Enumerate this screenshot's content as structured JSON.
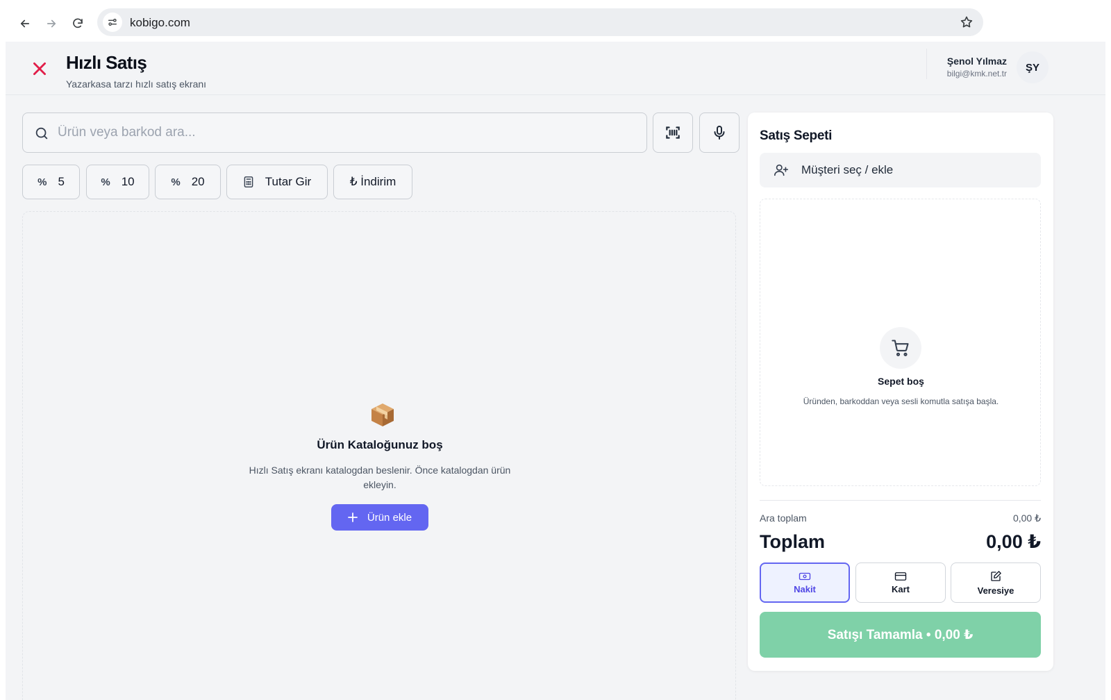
{
  "browser": {
    "url": "kobigo.com",
    "icons": {
      "back": "arrow-left-icon",
      "forward": "arrow-right-icon",
      "reload": "reload-icon",
      "site_info": "tune-icon",
      "bookmark": "star-icon"
    }
  },
  "header": {
    "title": "Hızlı Satış",
    "subtitle": "Yazarkasa tarzı hızlı satış ekranı",
    "user_name": "Şenol Yılmaz",
    "user_email": "bilgi@kmk.net.tr",
    "avatar_initials": "ŞY"
  },
  "search": {
    "placeholder": "Ürün veya barkod ara...",
    "value": ""
  },
  "quick_actions": [
    {
      "icon": "%",
      "label": "5"
    },
    {
      "icon": "%",
      "label": "10"
    },
    {
      "icon": "%",
      "label": "20"
    },
    {
      "icon": "calculator-icon",
      "label": "Tutar Gir"
    },
    {
      "icon": "lira-icon",
      "label": "₺ İndirim"
    }
  ],
  "catalog": {
    "empty_title": "Ürün Kataloğunuz boş",
    "empty_description": "Hızlı Satış ekranı katalogdan beslenir. Önce katalogdan ürün ekleyin.",
    "add_button_label": "Ürün ekle"
  },
  "cart": {
    "title": "Satış Sepeti",
    "customer_button_label": "Müşteri seç / ekle",
    "empty_title": "Sepet boş",
    "empty_description": "Üründen, barkoddan veya sesli komutla satışa başla.",
    "subtotal_label": "Ara toplam",
    "subtotal_value": "0,00 ₺",
    "total_label": "Toplam",
    "total_value": "0,00 ₺",
    "payment_methods": [
      {
        "label": "Nakit",
        "icon": "cash-icon",
        "selected": true
      },
      {
        "label": "Kart",
        "icon": "credit-card-icon",
        "selected": false
      },
      {
        "label": "Veresiye",
        "icon": "note-edit-icon",
        "selected": false
      }
    ],
    "complete_button_label": "Satışı Tamamla • 0,00 ₺"
  },
  "colors": {
    "accent": "#6366f1",
    "close": "#e11d48",
    "complete_button": "#7fd1a8",
    "background": "#f3f4f6"
  }
}
